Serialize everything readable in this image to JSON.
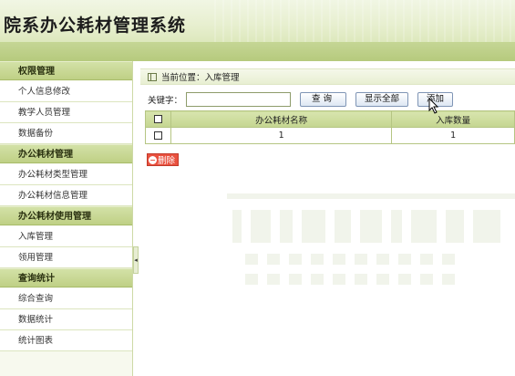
{
  "header": {
    "title": "院系办公耗材管理系统"
  },
  "sidebar": {
    "groups": [
      {
        "title": "权限管理",
        "items": [
          "个人信息修改",
          "教学人员管理",
          "数据备份"
        ]
      },
      {
        "title": "办公耗材管理",
        "items": [
          "办公耗材类型管理",
          "办公耗材信息管理"
        ]
      },
      {
        "title": "办公耗材使用管理",
        "items": [
          "入库管理",
          "领用管理"
        ]
      },
      {
        "title": "查询统计",
        "items": [
          "综合查询",
          "数据统计",
          "统计图表"
        ]
      }
    ],
    "collapse_arrow": "◂"
  },
  "breadcrumb": {
    "text": "当前位置：入库管理"
  },
  "search": {
    "label": "关键字：",
    "value": "",
    "query_button": "查询",
    "show_all_button": "显示全部",
    "add_button": "添加"
  },
  "table": {
    "headers": [
      "",
      "办公耗材名称",
      "入库数量"
    ],
    "rows": [
      {
        "name": "1",
        "quantity": "1"
      }
    ]
  },
  "actions": {
    "delete_button": "删除"
  },
  "colors": {
    "accent_green": "#c4d590",
    "delete_red": "#e9513f"
  }
}
